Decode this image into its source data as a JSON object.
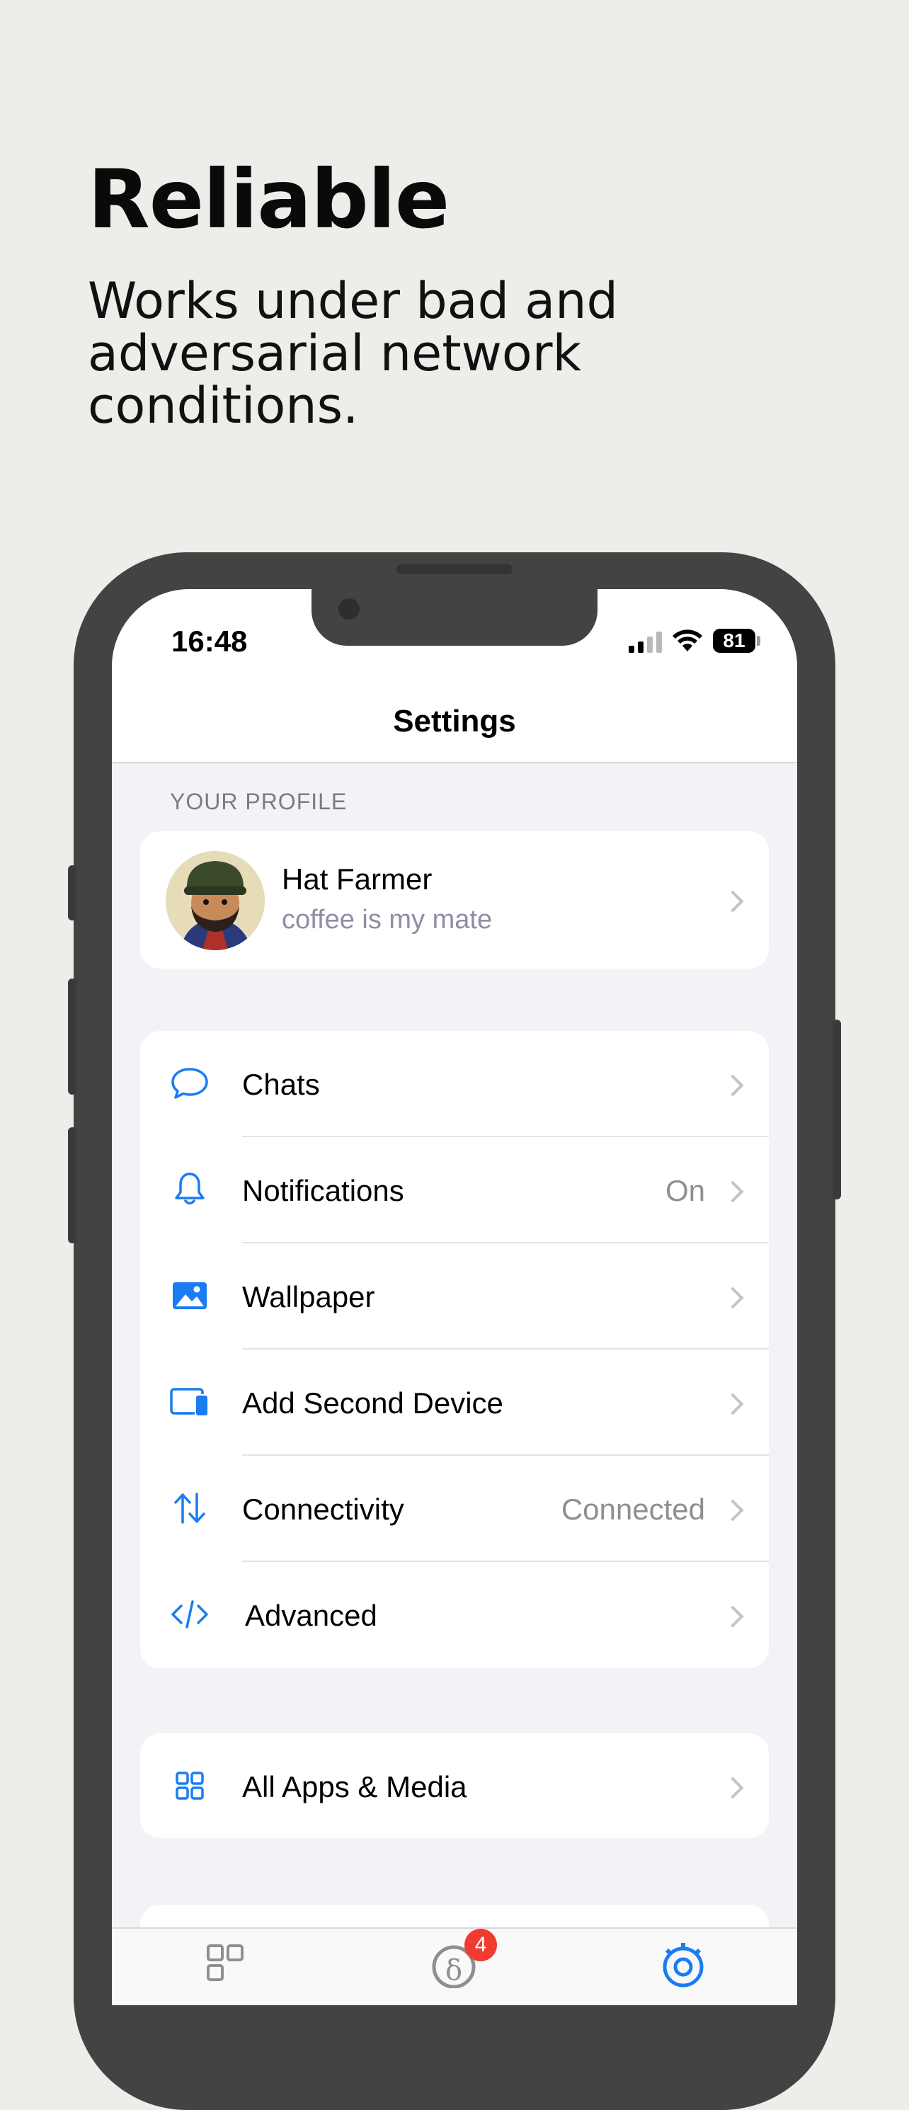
{
  "hero": {
    "title": "Reliable",
    "subtitle": "Works under bad and adversarial network conditions."
  },
  "status_bar": {
    "time": "16:48",
    "battery": "81"
  },
  "nav": {
    "title": "Settings"
  },
  "profile_section": {
    "header": "YOUR PROFILE",
    "name": "Hat Farmer",
    "status": "coffee is my mate"
  },
  "settings": {
    "items": [
      {
        "label": "Chats",
        "value": "",
        "icon": "chat-bubble-icon"
      },
      {
        "label": "Notifications",
        "value": "On",
        "icon": "bell-icon"
      },
      {
        "label": "Wallpaper",
        "value": "",
        "icon": "image-icon"
      },
      {
        "label": "Add Second Device",
        "value": "",
        "icon": "devices-icon"
      },
      {
        "label": "Connectivity",
        "value": "Connected",
        "icon": "arrows-updown-icon"
      },
      {
        "label": "Advanced",
        "value": "",
        "icon": "code-icon"
      }
    ]
  },
  "apps": {
    "label": "All Apps & Media",
    "icon": "grid-icon"
  },
  "tabbar": {
    "items": [
      {
        "icon": "qr-code-icon"
      },
      {
        "icon": "chats-tab-icon",
        "badge": "4"
      },
      {
        "icon": "settings-gear-icon"
      }
    ]
  },
  "colors": {
    "accent": "#1a7cf2",
    "background": "#efedea",
    "phone_frame": "#434343",
    "badge": "#f23b30"
  }
}
